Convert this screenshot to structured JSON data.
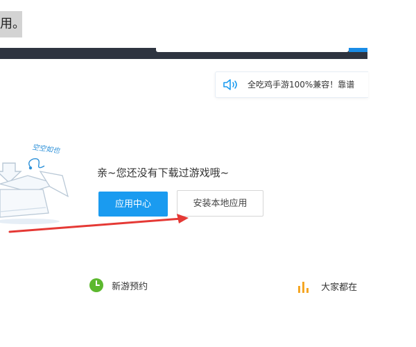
{
  "caption": {
    "text": "用。"
  },
  "notice": {
    "text": "全吃鸡手游100%兼容！靠谱"
  },
  "illustration": {
    "caption": "空空如也"
  },
  "empty_state": {
    "message": "亲~您还没有下载过游戏哦~",
    "app_center_label": "应用中心",
    "install_local_label": "安装本地应用"
  },
  "sections": {
    "new_games": "新游预约",
    "popular": "大家都在"
  },
  "colors": {
    "topbar": "#2e3440",
    "primary_blue": "#1a9bf0",
    "arrow_red": "#e53935",
    "new_games_green": "#5cb82e",
    "popular_orange": "#f5a623"
  },
  "icons": {
    "notice": "speaker-icon",
    "new_games": "clock-icon",
    "popular": "bar-chart-icon"
  }
}
